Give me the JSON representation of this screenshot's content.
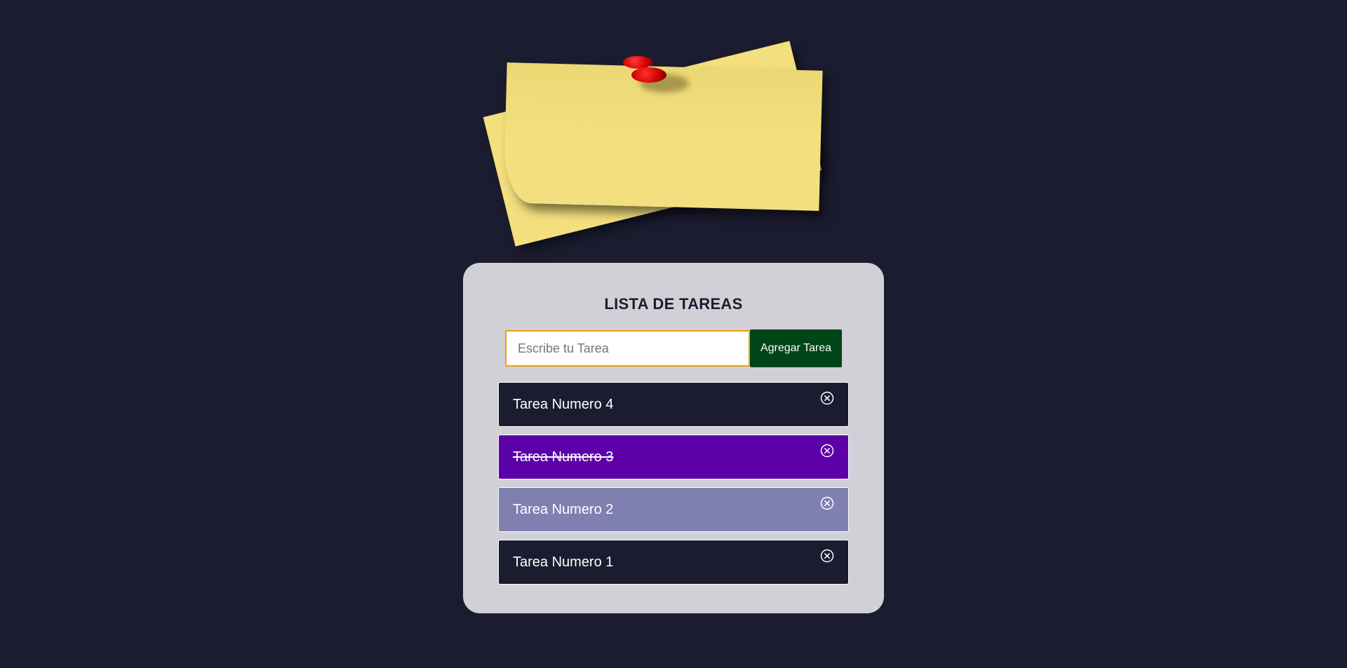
{
  "card": {
    "title": "LISTA DE TAREAS"
  },
  "form": {
    "input_value": "",
    "input_placeholder": "Escribe tu Tarea",
    "add_label": "Agregar Tarea"
  },
  "tasks": [
    {
      "label": "Tarea Numero 4",
      "completed": false,
      "color": "#1c1c30"
    },
    {
      "label": "Tarea Numero 3",
      "completed": true,
      "color": "#5c00a8"
    },
    {
      "label": "Tarea Numero 2",
      "completed": false,
      "color": "#7f80b0"
    },
    {
      "label": "Tarea Numero 1",
      "completed": false,
      "color": "#1c1c30"
    }
  ],
  "icons": {
    "delete": "close-circle-icon",
    "header_image": "sticky-notes-with-pushpin"
  },
  "colors": {
    "background": "#1c1c30",
    "card": "#d0d0d6",
    "input_border": "#f0a000",
    "add_button": "#004517"
  }
}
